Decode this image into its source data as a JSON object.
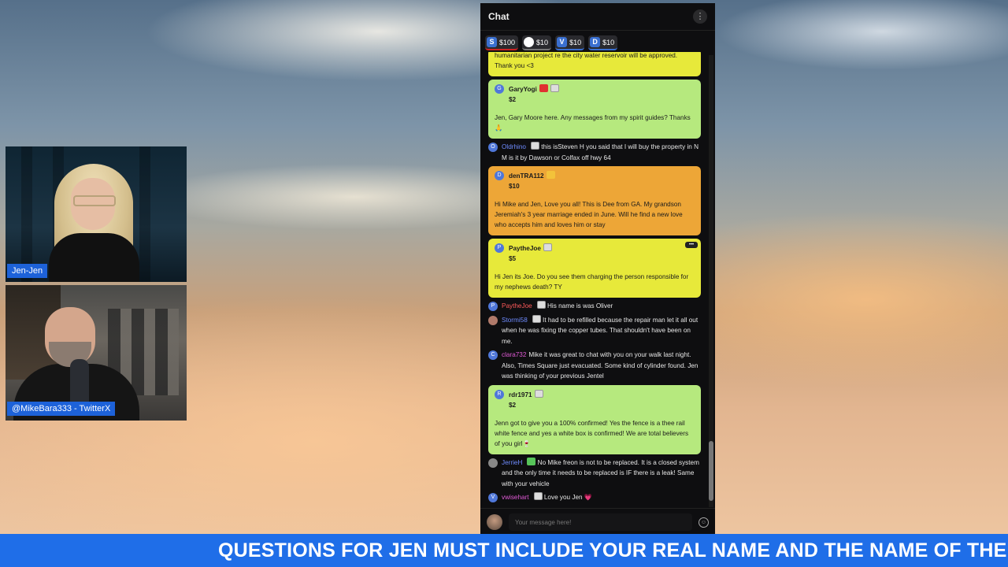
{
  "stream": {
    "cam1_label": "Jen-Jen",
    "cam2_label": "@MikeBara333 - TwitterX",
    "ticker": "QUESTIONS FOR JEN MUST INCLUDE YOUR REAL NAME AND THE NAME OF THE"
  },
  "chat": {
    "title": "Chat",
    "menu_icon": "⋮",
    "tips": [
      {
        "icon": "S",
        "amount": "$100"
      },
      {
        "icon": "",
        "amount": "$10"
      },
      {
        "icon": "V",
        "amount": "$10"
      },
      {
        "icon": "D",
        "amount": "$10"
      }
    ],
    "cards": {
      "top_partial": "humanitarian project re the city water reservoir will be approved. Thank you <3",
      "garyyogi": {
        "avatar": "G",
        "name": "GaryYogi",
        "amount": "$2",
        "text": "Jen, Gary Moore here. Any messages from my spirit guides? Thanks 🙏"
      },
      "dentra": {
        "avatar": "D",
        "name": "denTRA112",
        "amount": "$10",
        "text": "Hi Mike and Jen, Love you all! This is Dee from GA. My grandson Jeremiah's 3 year marriage ended in June. Will he find a new love who accepts him and loves him or stay"
      },
      "paythejoe": {
        "avatar": "P",
        "name": "PaytheJoe",
        "amount": "$5",
        "text": "Hi Jen its Joe. Do you see them charging the person responsible for my nephews death? TY",
        "more": "•••"
      },
      "rdr1971": {
        "avatar": "R",
        "name": "rdr1971",
        "amount": "$2",
        "text": "Jenn got to give you a 100% confirmed! Yes the fence is a thee rail white fence and yes a white box is confirmed! We are total believers of you girl🍷"
      }
    },
    "messages": {
      "oldrhino": {
        "avatar": "O",
        "name": "Oldrhino",
        "text": "this isSteven H you said that I will buy the property in N M is it by Dawson or Colfax off hwy 64"
      },
      "paythejoe2": {
        "avatar": "P",
        "name": "PaytheJoe",
        "text": "His name is was Oliver"
      },
      "stormi58": {
        "avatar": "",
        "name": "Stormi58",
        "text": "It had to be refilled because the repair man let it all out when he was fixing the copper tubes. That shouldn't have been on me."
      },
      "clara732": {
        "avatar": "C",
        "name": "clara732",
        "text": "Mike it was great to chat with you on your walk last night. Also, Times Square just evacuated. Some kind of cylinder found. Jen was thinking of your previous Jentel"
      },
      "jerrieh": {
        "avatar": "",
        "name": "JerrieH",
        "text": "No Mike freon is not to be replaced. It is a closed system and the only time it needs to be replaced is IF there is a leak! Same with your vehicle"
      },
      "vwisehart": {
        "avatar": "V",
        "name": "vwisehart",
        "text": "Love you Jen 💗"
      }
    },
    "input_placeholder": "Your message here!",
    "emoji_icon": "☺",
    "colors": {
      "yellow": "#e7e93a",
      "green": "#b6e97e",
      "orange": "#eda637",
      "ticker": "#1f6ee8"
    }
  }
}
